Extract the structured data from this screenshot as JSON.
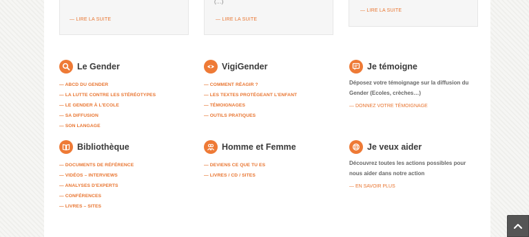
{
  "top_cards": [
    {
      "dots": "",
      "link": "— LIRE LA SUITE"
    },
    {
      "dots": "(…)",
      "link": "— LIRE LA SUITE"
    },
    {
      "dots": "",
      "link": "— LIRE LA SUITE"
    }
  ],
  "sections": {
    "gender": {
      "icon": "search-icon",
      "title": "Le Gender",
      "links": [
        "— ABCD DU GENDER",
        "— LA LUTTE CONTRE LES STÉRÉOTYPES",
        "— LE GENDER À L'ECOLE",
        "— SA DIFFUSION",
        "— SON LANGAGE"
      ]
    },
    "vigigender": {
      "icon": "eye-icon",
      "title": "VigiGender",
      "links": [
        "— COMMENT RÉAGIR ?",
        "— LES TEXTES PROTÉGEANT L'ENFANT",
        "— TÉMOIGNAGES",
        "— OUTILS PRATIQUES"
      ]
    },
    "temoigne": {
      "icon": "chat-icon",
      "title": "Je témoigne",
      "description": "Déposez votre témoignage sur la diffusion du Gender (Ecoles, crèches…)",
      "link": "— DONNEZ VOTRE TÉMOIGNAGE"
    },
    "bibliotheque": {
      "icon": "book-icon",
      "title": "Bibliothèque",
      "links": [
        "— DOCUMENTS DE RÉFÉRENCE",
        "— VIDÉOS – INTERVIEWS",
        "— ANALYSES D'EXPERTS",
        "— CONFÉRENCES",
        "— LIVRES – SITES"
      ]
    },
    "homme_femme": {
      "icon": "people-icon",
      "title": "Homme et Femme",
      "links": [
        "— DEVIENS CE QUE TU ES",
        "— LIVRES / CD / SITES"
      ]
    },
    "aider": {
      "icon": "lifebuoy-icon",
      "title": "Je veux aider",
      "description": "Découvrez toutes les actions possibles pour nous aider dans notre action",
      "link": "— EN SAVOIR PLUS"
    }
  },
  "scroll_top": {
    "icon": "chevron-up-icon"
  },
  "colors": {
    "accent": "#ee7a36",
    "link": "#e8742f",
    "title": "#3a3a3a",
    "text": "#666666"
  }
}
